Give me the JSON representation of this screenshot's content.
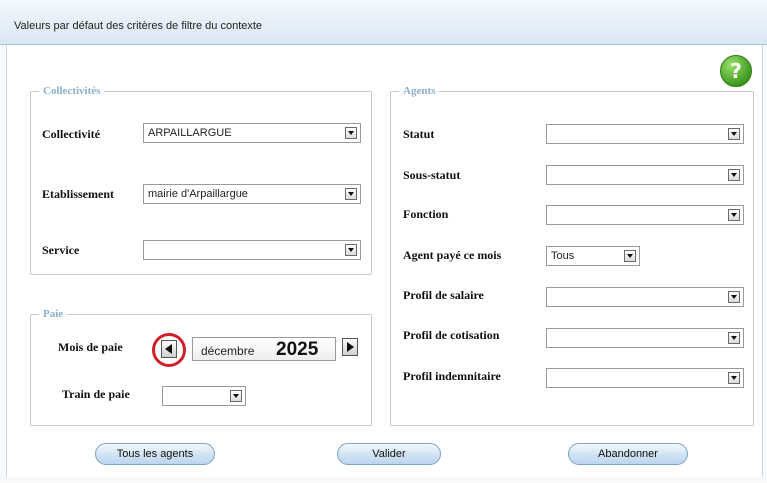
{
  "window": {
    "title": "Valeurs par défaut des critères de filtre du contexte"
  },
  "collectivites": {
    "legend": "Collectivités",
    "collectivite": {
      "label": "Collectivité",
      "value": "ARPAILLARGUE"
    },
    "etablissement": {
      "label": "Etablissement",
      "value": "mairie d'Arpaillargue"
    },
    "service": {
      "label": "Service",
      "value": ""
    }
  },
  "paie": {
    "legend": "Paie",
    "mois_label": "Mois de paie",
    "month": "décembre",
    "year": "2025",
    "train_label": "Train de paie",
    "train_value": ""
  },
  "agents": {
    "legend": "Agents",
    "statut": {
      "label": "Statut",
      "value": ""
    },
    "sous_statut": {
      "label": "Sous-statut",
      "value": ""
    },
    "fonction": {
      "label": "Fonction",
      "value": ""
    },
    "agent_paye": {
      "label": "Agent payé ce mois",
      "value": "Tous"
    },
    "profil_salaire": {
      "label": "Profil de salaire",
      "value": ""
    },
    "profil_cotisation": {
      "label": "Profil de cotisation",
      "value": ""
    },
    "profil_indemnitaire": {
      "label": "Profil indemnitaire",
      "value": ""
    }
  },
  "buttons": {
    "tous_agents": "Tous les agents",
    "valider": "Valider",
    "abandonner": "Abandonner"
  },
  "colors": {
    "highlight": "#d0202a",
    "help": "#3d9a1f",
    "legend": "#8ab0d0"
  },
  "icons": {
    "help": "help-icon",
    "prev": "arrow-left-icon",
    "next": "arrow-right-icon",
    "dropdown": "chevron-down-icon"
  }
}
